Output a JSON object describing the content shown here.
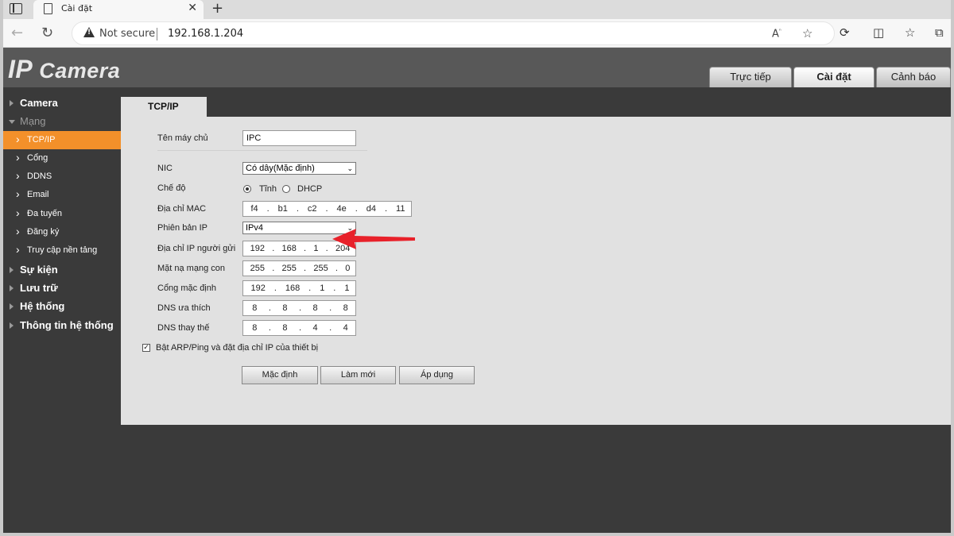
{
  "browser": {
    "tab_title": "Cài đặt",
    "new_tab": "+",
    "close": "✕",
    "not_secure": "Not secure",
    "url": "192.168.1.204"
  },
  "header": {
    "logo_ip": "IP",
    "logo_camera": "Camera",
    "tabs": [
      {
        "label": "Trực tiếp"
      },
      {
        "label": "Cài đặt"
      },
      {
        "label": "Cảnh báo"
      }
    ]
  },
  "sidebar": {
    "items": [
      {
        "label": "Camera"
      },
      {
        "label": "Mạng"
      },
      {
        "label": "TCP/IP"
      },
      {
        "label": "Cổng"
      },
      {
        "label": "DDNS"
      },
      {
        "label": "Email"
      },
      {
        "label": "Đa tuyến"
      },
      {
        "label": "Đăng ký"
      },
      {
        "label": "Truy cập nền tảng"
      },
      {
        "label": "Sự kiện"
      },
      {
        "label": "Lưu trữ"
      },
      {
        "label": "Hệ thống"
      },
      {
        "label": "Thông tin hệ thống"
      }
    ]
  },
  "content": {
    "tab": "TCP/IP",
    "hostname": {
      "label": "Tên máy chủ",
      "value": "IPC"
    },
    "nic": {
      "label": "NIC",
      "value": "Có dây(Mặc định)"
    },
    "mode": {
      "label": "Chế độ",
      "static": "Tĩnh",
      "dhcp": "DHCP"
    },
    "mac": {
      "label": "Địa chỉ MAC",
      "octets": [
        "f4",
        "b1",
        "c2",
        "4e",
        "d4",
        "11"
      ]
    },
    "ip_version": {
      "label": "Phiên bản IP",
      "value": "IPv4"
    },
    "ip_address": {
      "label": "Địa chỉ IP người gửi",
      "octets": [
        "192",
        "168",
        "1",
        "204"
      ]
    },
    "subnet": {
      "label": "Mặt nạ mạng con",
      "octets": [
        "255",
        "255",
        "255",
        "0"
      ]
    },
    "gateway": {
      "label": "Cổng mặc định",
      "octets": [
        "192",
        "168",
        "1",
        "1"
      ]
    },
    "dns_primary": {
      "label": "DNS ưa thích",
      "octets": [
        "8",
        "8",
        "8",
        "8"
      ]
    },
    "dns_secondary": {
      "label": "DNS thay thế",
      "octets": [
        "8",
        "8",
        "4",
        "4"
      ]
    },
    "arp_ping": {
      "label": "Bật ARP/Ping và đặt địa chỉ IP của thiết bị",
      "checked": true
    },
    "buttons": {
      "default": "Mặc định",
      "refresh": "Làm mới",
      "apply": "Áp dụng"
    }
  },
  "colors": {
    "active_sidebar": "#f3902a",
    "arrow": "#e8212a"
  }
}
